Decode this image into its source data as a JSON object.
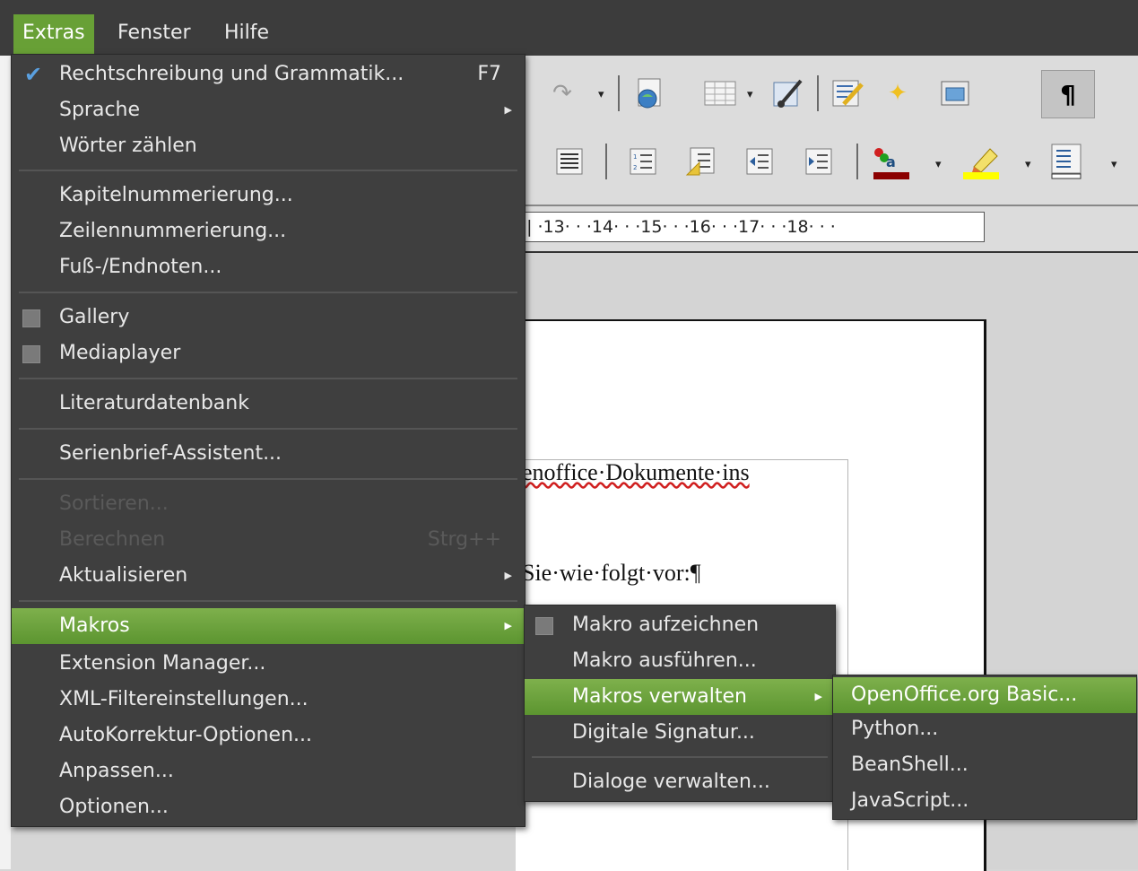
{
  "menubar": {
    "extras": "Extras",
    "fenster": "Fenster",
    "hilfe": "Hilfe"
  },
  "ruler": {
    "ticks": "· | ·13· · ·14· · ·15· · ·16· · ·17· · ·18· · ·"
  },
  "document": {
    "line1": "enoffice·Dokumente·ins",
    "line2": "Sie·wie·folgt·vor:¶"
  },
  "extras_menu": {
    "items": [
      {
        "label": "Rechtschreibung und Grammatik...",
        "shortcut": "F7"
      },
      {
        "label": "Sprache"
      },
      {
        "label": "Wörter zählen"
      },
      {
        "label": "Kapitelnummerierung..."
      },
      {
        "label": "Zeilennummerierung..."
      },
      {
        "label": "Fuß-/Endnoten..."
      },
      {
        "label": "Gallery"
      },
      {
        "label": "Mediaplayer"
      },
      {
        "label": "Literaturdatenbank"
      },
      {
        "label": "Serienbrief-Assistent..."
      },
      {
        "label": "Sortieren..."
      },
      {
        "label": "Berechnen",
        "shortcut": "Strg++"
      },
      {
        "label": "Aktualisieren"
      },
      {
        "label": "Makros"
      },
      {
        "label": "Extension Manager..."
      },
      {
        "label": "XML-Filtereinstellungen..."
      },
      {
        "label": "AutoKorrektur-Optionen..."
      },
      {
        "label": "Anpassen..."
      },
      {
        "label": "Optionen..."
      }
    ]
  },
  "makros_menu": {
    "items": [
      {
        "label": "Makro aufzeichnen"
      },
      {
        "label": "Makro ausführen..."
      },
      {
        "label": "Makros verwalten"
      },
      {
        "label": "Digitale Signatur..."
      },
      {
        "label": "Dialoge verwalten..."
      }
    ]
  },
  "verwalten_menu": {
    "items": [
      {
        "label": "OpenOffice.org Basic..."
      },
      {
        "label": "Python..."
      },
      {
        "label": "BeanShell..."
      },
      {
        "label": "JavaScript..."
      }
    ]
  },
  "colors": {
    "highlight": "#68a036",
    "menu_bg": "#3f3f3f"
  }
}
